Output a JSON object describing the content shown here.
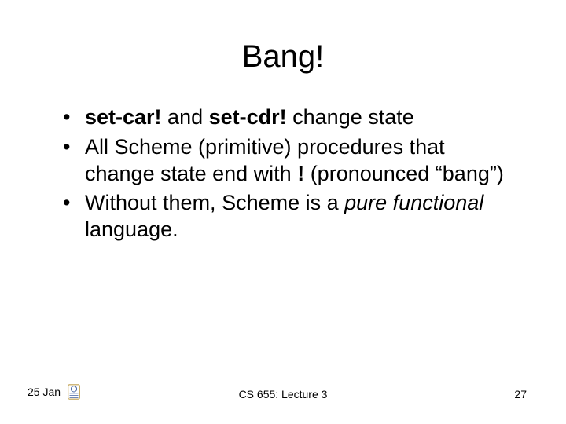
{
  "title": "Bang!",
  "bullets": {
    "b1": {
      "s1": "set-car!",
      "s2": " and ",
      "s3": "set-cdr!",
      "s4": " change state"
    },
    "b2": {
      "s1": "All Scheme (primitive) procedures that change state end with ",
      "s2": "!",
      "s3": " (pronounced “bang”)"
    },
    "b3": {
      "s1": "Without them, Scheme is a ",
      "s2": "pure functional",
      "s3": " language."
    }
  },
  "footer": {
    "date": "25 Jan",
    "course": "CS 655: Lecture 3",
    "page": "27"
  }
}
